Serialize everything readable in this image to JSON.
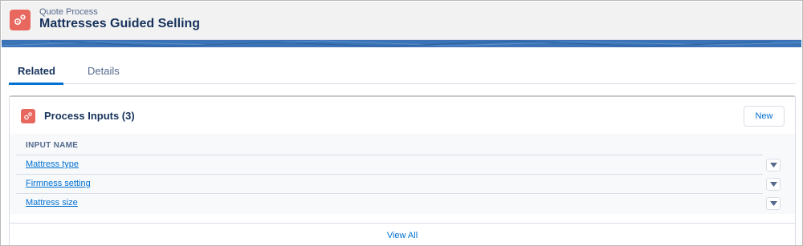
{
  "header": {
    "object_label": "Quote Process",
    "title": "Mattresses Guided Selling",
    "icon": "gears-icon",
    "icon_color": "#e8685f"
  },
  "band_color": "#3b73b6",
  "tabs": [
    {
      "label": "Related",
      "active": true
    },
    {
      "label": "Details",
      "active": false
    }
  ],
  "card": {
    "icon": "gears-icon",
    "title": "Process Inputs (3)",
    "new_label": "New",
    "column_header": "INPUT NAME",
    "rows": [
      {
        "name": "Mattress type",
        "action_icon": "chevron-down-icon"
      },
      {
        "name": "Firmness setting",
        "action_icon": "chevron-down-icon"
      },
      {
        "name": "Mattress size",
        "action_icon": "chevron-down-icon"
      }
    ],
    "view_all": "View All"
  },
  "colors": {
    "link": "#0070d2",
    "text": "#16325c",
    "active_tab_underline": "#0070d2"
  }
}
